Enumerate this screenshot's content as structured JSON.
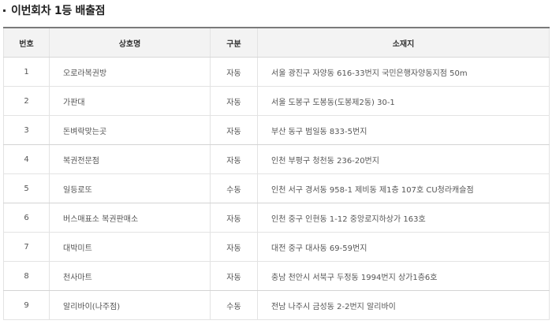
{
  "section": {
    "title": "이번회차 1등 배출점"
  },
  "table": {
    "headers": [
      "번호",
      "상호명",
      "구분",
      "소재지"
    ],
    "rows": [
      {
        "no": "1",
        "name": "오로라복권방",
        "type": "자동",
        "address": "서울 광진구 자양동 616-33번지 국민은행자양동지점 50m"
      },
      {
        "no": "2",
        "name": "가판대",
        "type": "자동",
        "address": "서울 도봉구 도봉동(도봉제2동) 30-1"
      },
      {
        "no": "3",
        "name": "돈벼락맞는곳",
        "type": "자동",
        "address": "부산 동구 범일동 833-5번지"
      },
      {
        "no": "4",
        "name": "복권전문점",
        "type": "자동",
        "address": "인천 부평구 청천동 236-20번지"
      },
      {
        "no": "5",
        "name": "일등로또",
        "type": "수동",
        "address": "인천 서구 경서동 958-1 제비동 제1층 107호 CU청라캐슬점"
      },
      {
        "no": "6",
        "name": "버스매표소 복권판매소",
        "type": "자동",
        "address": "인천 중구 인현동 1-12 중앙로지하상가 163호"
      },
      {
        "no": "7",
        "name": "대박미트",
        "type": "자동",
        "address": "대전 중구 대사동 69-59번지"
      },
      {
        "no": "8",
        "name": "천사마트",
        "type": "자동",
        "address": "충남 천안시 서북구 두정동 1994번지 상가1층6호"
      },
      {
        "no": "9",
        "name": "알리바이(나주점)",
        "type": "수동",
        "address": "전남 나주시 금성동 2-2번지 알리바이"
      }
    ]
  }
}
